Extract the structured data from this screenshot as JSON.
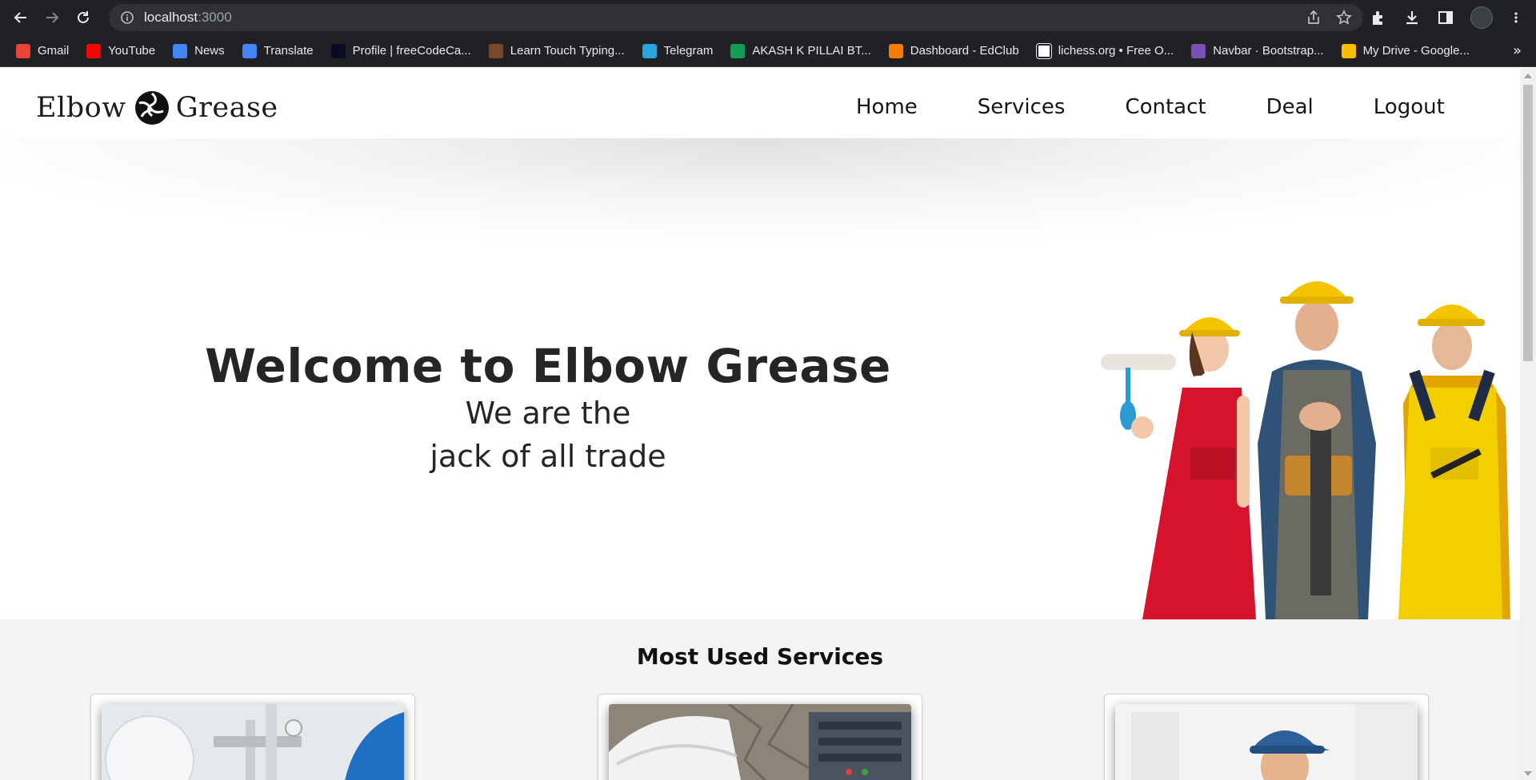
{
  "browser": {
    "url_host": "localhost",
    "url_port": ":3000",
    "bookmarks": [
      {
        "label": "Gmail",
        "icon": "gmail-icon",
        "color": "#ea4335"
      },
      {
        "label": "YouTube",
        "icon": "youtube-icon",
        "color": "#ff0000"
      },
      {
        "label": "News",
        "icon": "news-icon",
        "color": "#4285f4"
      },
      {
        "label": "Translate",
        "icon": "translate-icon",
        "color": "#4285f4"
      },
      {
        "label": "Profile | freeCodeCa...",
        "icon": "freecodecamp-icon",
        "color": "#0a0a23"
      },
      {
        "label": "Learn Touch Typing...",
        "icon": "typing-icon",
        "color": "#7a4b2a"
      },
      {
        "label": "Telegram",
        "icon": "telegram-icon",
        "color": "#2aa3df"
      },
      {
        "label": "AKASH K PILLAI BT...",
        "icon": "sheets-icon",
        "color": "#0f9d58"
      },
      {
        "label": "Dashboard - EdClub",
        "icon": "edclub-icon",
        "color": "#f57c00"
      },
      {
        "label": "lichess.org • Free O...",
        "icon": "lichess-icon",
        "color": "#ffffff"
      },
      {
        "label": "Navbar · Bootstrap...",
        "icon": "bootstrap-icon",
        "color": "#7952b3"
      },
      {
        "label": "My Drive - Google...",
        "icon": "drive-icon",
        "color": "#fbbc04"
      }
    ],
    "more_label": "»"
  },
  "site": {
    "logo_left": "Elbow",
    "logo_right": "Grease",
    "nav": [
      "Home",
      "Services",
      "Contact",
      "Deal",
      "Logout"
    ]
  },
  "hero": {
    "title": "Welcome to Elbow Grease",
    "subtitle_line1": "We are the",
    "subtitle_line2": "jack of all trade"
  },
  "services": {
    "title": "Most Used Services"
  },
  "colors": {
    "chrome_bg": "#202124",
    "omnibox_bg": "#303134",
    "section_bg": "#f4f4f4",
    "helmet_yellow": "#f5c400",
    "overall_red": "#d6132a"
  }
}
